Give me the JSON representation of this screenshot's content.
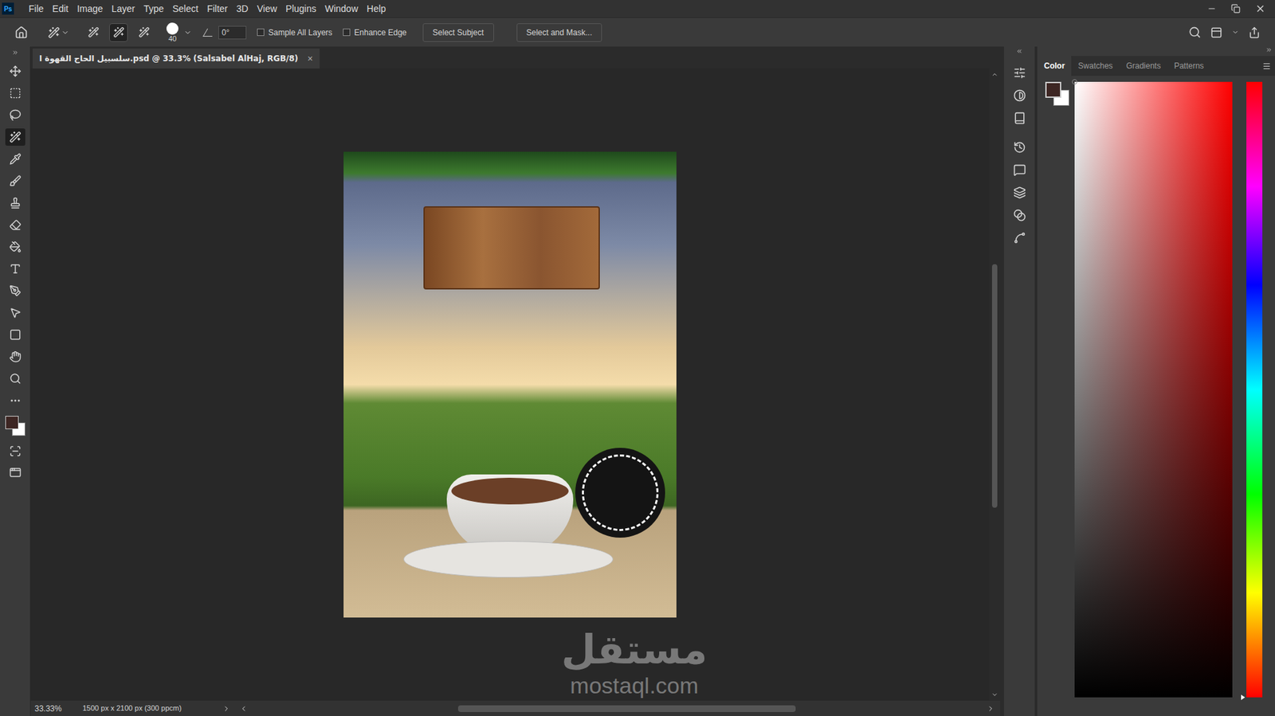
{
  "app": {
    "logo": "Ps",
    "menu": [
      "File",
      "Edit",
      "Image",
      "Layer",
      "Type",
      "Select",
      "Filter",
      "3D",
      "View",
      "Plugins",
      "Window",
      "Help"
    ]
  },
  "options_bar": {
    "modes": [
      {
        "selected": false
      },
      {
        "selected": true
      },
      {
        "selected": false
      }
    ],
    "brush_size": "40",
    "angle": "0°",
    "checkboxes": [
      {
        "label": "Sample All Layers",
        "checked": false
      },
      {
        "label": "Enhance Edge",
        "checked": false
      }
    ],
    "buttons": [
      "Select Subject",
      "Select and Mask..."
    ]
  },
  "document_tab": {
    "title": "سلسبيل الحاج القهوة ا.psd @ 33.3% (Salsabel AlHaj, RGB/8)",
    "close": "×",
    "selected": true
  },
  "toolbar": {
    "tools": [
      {
        "selected": false
      },
      {
        "selected": false
      },
      {
        "selected": false
      },
      {
        "selected": true
      },
      {
        "selected": false
      },
      {
        "selected": false
      },
      {
        "selected": false
      },
      {
        "selected": false
      },
      {
        "selected": false
      },
      {
        "selected": false
      },
      {
        "selected": false
      },
      {
        "selected": false
      },
      {
        "selected": false
      },
      {
        "selected": false
      },
      {
        "selected": false
      },
      {
        "selected": false
      }
    ],
    "foreground_color": "#3d2623",
    "background_color": "#ffffff"
  },
  "watermark": {
    "arabic": "مستقل",
    "latin": "mostaql.com"
  },
  "status_bar": {
    "zoom": "33.33%",
    "doc_info": "1500 px x 2100 px (300 ppcm)"
  },
  "color_panel": {
    "tabs": [
      {
        "label": "Color",
        "selected": true
      },
      {
        "label": "Swatches",
        "selected": false
      },
      {
        "label": "Gradients",
        "selected": false
      },
      {
        "label": "Patterns",
        "selected": false
      }
    ],
    "foreground_color": "#3d2623",
    "background_color": "#ffffff"
  }
}
